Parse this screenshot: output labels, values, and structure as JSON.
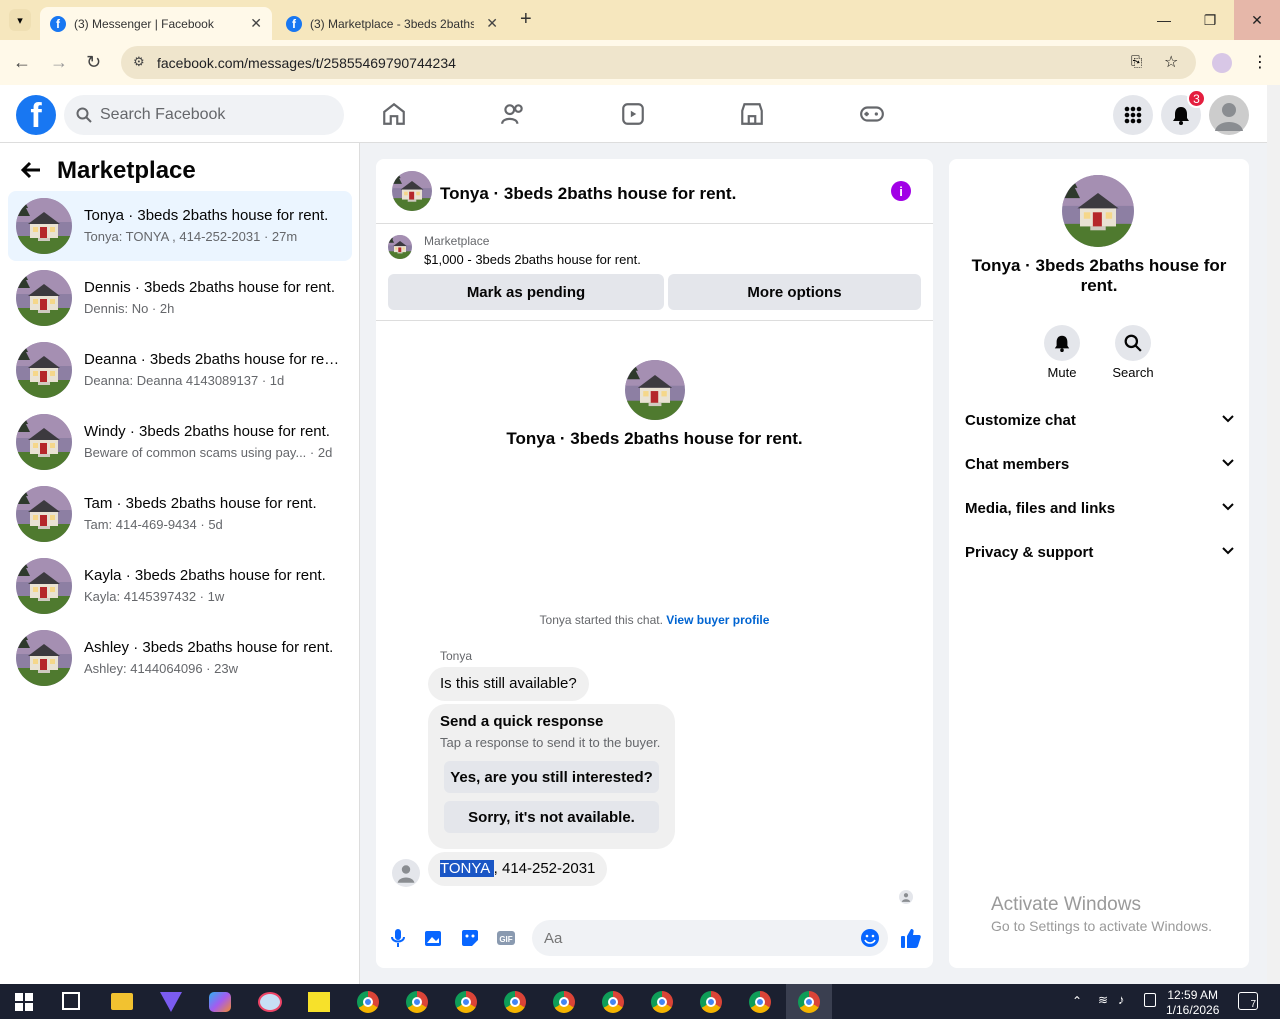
{
  "browser": {
    "tabs": [
      {
        "title": "(3) Messenger | Facebook",
        "active": true
      },
      {
        "title": "(3) Marketplace - 3beds 2baths",
        "active": false
      }
    ],
    "url": "facebook.com/messages/t/25855469790744234"
  },
  "fb_header": {
    "search_placeholder": "Search Facebook",
    "notification_count": "3"
  },
  "sidebar": {
    "title": "Marketplace",
    "conversations": [
      {
        "name": "Tonya · 3beds 2baths house for rent.",
        "snippet": "Tonya: TONYA , 414-252-2031",
        "time": "27m",
        "selected": true
      },
      {
        "name": "Dennis · 3beds 2baths house for rent.",
        "snippet": "Dennis: No",
        "time": "2h"
      },
      {
        "name": "Deanna · 3beds 2baths house for rent.",
        "snippet": "Deanna: Deanna 4143089137",
        "time": "1d"
      },
      {
        "name": "Windy · 3beds 2baths house for rent.",
        "snippet": "Beware of common scams using pay...",
        "time": "2d"
      },
      {
        "name": "Tam · 3beds 2baths house for rent.",
        "snippet": "Tam: 414-469-9434",
        "time": "5d"
      },
      {
        "name": "Kayla · 3beds 2baths house for rent.",
        "snippet": "Kayla: 4145397432",
        "time": "1w"
      },
      {
        "name": "Ashley · 3beds 2baths house for rent.",
        "snippet": "Ashley: 4144064096",
        "time": "23w"
      }
    ]
  },
  "chat": {
    "title": "Tonya · 3beds 2baths house for rent.",
    "listing_label": "Marketplace",
    "listing_title": "$1,000 - 3beds 2baths house for rent.",
    "mark_pending": "Mark as pending",
    "more_options": "More options",
    "intro_title": "Tonya · 3beds 2baths house for rent.",
    "started_text": "Tonya started this chat.",
    "view_profile": "View buyer profile",
    "sender_name": "Tonya",
    "message1": "Is this still available?",
    "quick_title": "Send a quick response",
    "quick_sub": "Tap a response to send it to the buyer.",
    "quick1": "Yes, are you still interested?",
    "quick2": "Sorry, it's not available.",
    "message2_highlight": "TONYA ",
    "message2_rest": ", 414-252-2031",
    "input_placeholder": "Aa"
  },
  "right_panel": {
    "title": "Tonya · 3beds 2baths house for rent.",
    "mute": "Mute",
    "search": "Search",
    "sections": [
      "Customize chat",
      "Chat members",
      "Media, files and links",
      "Privacy & support"
    ]
  },
  "watermark": {
    "line1": "Activate Windows",
    "line2": "Go to Settings to activate Windows."
  },
  "taskbar": {
    "time": "12:59 AM",
    "date": "1/16/2026",
    "notif": "7"
  }
}
